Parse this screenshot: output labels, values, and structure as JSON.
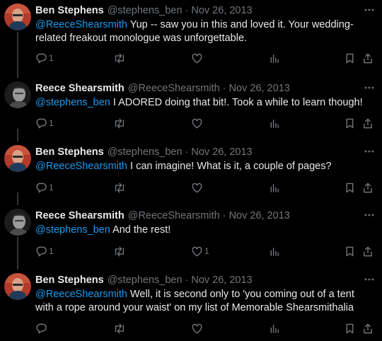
{
  "colors": {
    "background": "#000000",
    "text": "#e7e9ea",
    "secondary": "#71767b",
    "mention": "#1d9bf0",
    "thread_line": "#333639"
  },
  "tweets": [
    {
      "author": "Ben Stephens",
      "handle": "@stephens_ben",
      "separator": "·",
      "date": "Nov 26, 2013",
      "mention": "@ReeceShearsmith",
      "text": " Yup -- saw you in this and loved it. Your wedding-related freakout monologue was unforgettable.",
      "reply_count": "1",
      "like_count": ""
    },
    {
      "author": "Reece Shearsmith",
      "handle": "@ReeceShearsmith",
      "separator": "·",
      "date": "Nov 26, 2013",
      "mention": "@stephens_ben",
      "text": " I ADORED doing that bit!. Took a while to learn though!",
      "reply_count": "1",
      "like_count": ""
    },
    {
      "author": "Ben Stephens",
      "handle": "@stephens_ben",
      "separator": "·",
      "date": "Nov 26, 2013",
      "mention": "@ReeceShearsmith",
      "text": " I can imagine! What is it, a couple of pages?",
      "reply_count": "1",
      "like_count": ""
    },
    {
      "author": "Reece Shearsmith",
      "handle": "@ReeceShearsmith",
      "separator": "·",
      "date": "Nov 26, 2013",
      "mention": "@stephens_ben",
      "text": " And the rest!",
      "reply_count": "1",
      "like_count": "1"
    },
    {
      "author": "Ben Stephens",
      "handle": "@stephens_ben",
      "separator": "·",
      "date": "Nov 26, 2013",
      "mention": "@ReeceShearsmith",
      "text": " Well, it is second only to 'you coming out of a tent with a rope around your waist' on my list of Memorable Shearsmithalia",
      "reply_count": "",
      "like_count": ""
    }
  ]
}
